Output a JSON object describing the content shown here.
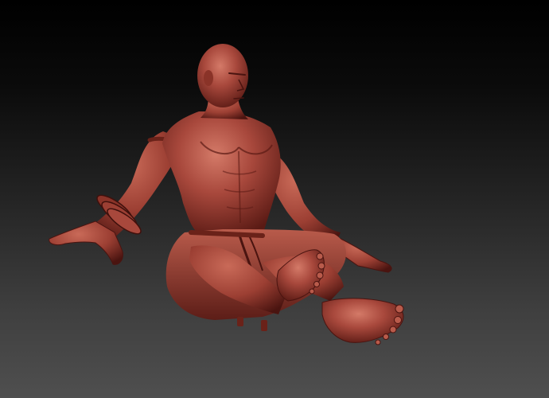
{
  "scene": {
    "subject": "sculpt-figure",
    "material": "red-clay",
    "colors": {
      "background_top": "#000000",
      "background_bottom": "#4f4f4f",
      "clay_base": "#a8483c",
      "clay_highlight": "#d47a68",
      "clay_shadow": "#4a1410"
    }
  }
}
